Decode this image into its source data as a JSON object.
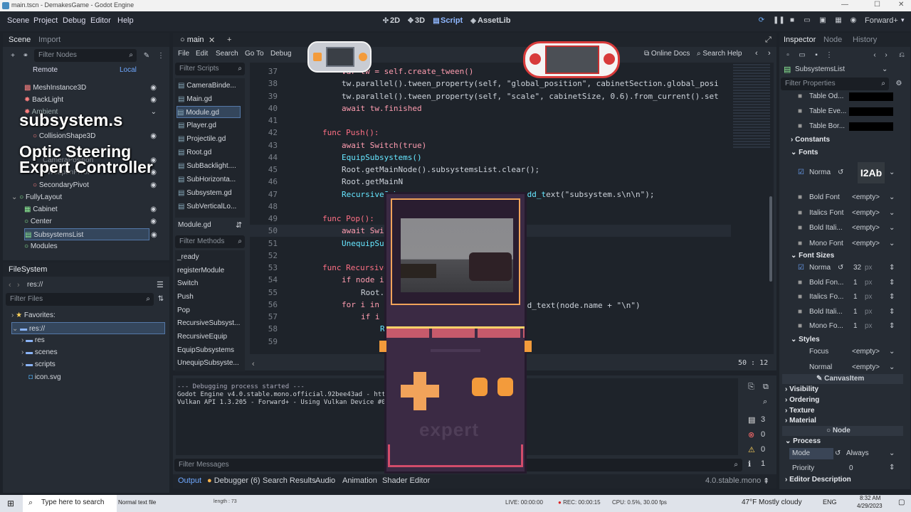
{
  "window": {
    "title": "main.tscn - DemakesGame - Godot Engine"
  },
  "menubar": {
    "items": [
      "Scene",
      "Project",
      "Debug",
      "Editor",
      "Help"
    ],
    "workspaces": [
      "2D",
      "3D",
      "Script",
      "AssetLib"
    ],
    "renderer": "Forward+"
  },
  "scene_dock": {
    "tabs": [
      "Scene",
      "Import"
    ],
    "filter_placeholder": "Filter Nodes",
    "remote": "Remote",
    "local": "Local",
    "nodes": [
      "MeshInstance3D",
      "BackLight",
      "Ambient",
      "",
      "CollisionShape3D",
      "",
      "CameraPosition",
      "WeaponPivot",
      "SecondaryPivot",
      "FullyLayout",
      "Cabinet",
      "Center",
      "SubsystemsList",
      "Modules"
    ]
  },
  "filesystem": {
    "title": "FileSystem",
    "path": "res://",
    "filter_placeholder": "Filter Files",
    "favorites": "Favorites:",
    "items": [
      "res://",
      "res",
      "scenes",
      "scripts",
      "icon.svg"
    ]
  },
  "script_editor": {
    "tab": "main",
    "menu": [
      "File",
      "Edit",
      "Search",
      "Go To",
      "Debug"
    ],
    "online_docs": "Online Docs",
    "search_help": "Search Help",
    "filter_scripts": "Filter Scripts",
    "scripts": [
      "CameraBinde...",
      "Main.gd",
      "Module.gd",
      "Player.gd",
      "Projectile.gd",
      "Root.gd",
      "SubBacklight....",
      "SubHorizonta...",
      "Subsystem.gd",
      "SubVerticalLo..."
    ],
    "current_script": "Module.gd",
    "filter_methods": "Filter Methods",
    "methods": [
      "_ready",
      "registerModule",
      "Switch",
      "Push",
      "Pop",
      "RecursiveSubsyst...",
      "RecursiveEquip",
      "EquipSubsystems",
      "UnequipSubsyste..."
    ],
    "line_numbers": [
      "37",
      "38",
      "39",
      "40",
      "41",
      "42",
      "43",
      "44",
      "45",
      "46",
      "47",
      "48",
      "49",
      "50",
      "51",
      "52",
      "53",
      "54",
      "55",
      "56",
      "57",
      "58",
      "59"
    ],
    "lines": [
      "var tw = self.create_tween()",
      "tw.parallel().tween_property(self, \"global_position\", cabinetSection.global_posi",
      "tw.parallel().tween_property(self, \"scale\", cabinetSize, 0.6).from_current().set",
      "await tw.finished",
      "",
      "func Push():",
      "await Switch(true)",
      "EquipSubsystems()",
      "Root.getMainNode().subsystemsList.clear();",
      "Root.getMainN",
      "RecursiveSubs",
      "",
      "func Pop():",
      "await Switch(",
      "UnequipSubsys",
      "",
      "func RecursiveSub",
      "if node is Su",
      "Root.getM",
      "for i in node",
      "if i is S",
      "Rec",
      ""
    ],
    "line47_tail": "ext(\"subsystem.s\\n\\n\");",
    "line56_tail": "nd_text(node.name + \"\\n\")",
    "cursor": "50 :  12"
  },
  "output": {
    "lines": [
      "--- Debugging process started ---",
      "Godot Engine v4.0.stable.mono.official.92bee43ad - https",
      "Vulkan API 1.3.205 - Forward+ - Using Vulkan Device #0:"
    ],
    "filter": "Filter Messages",
    "counts": [
      "3",
      "0",
      "0",
      "1"
    ],
    "bottom_tabs": [
      "Output",
      "Debugger (6)",
      "Search Results",
      "Audio",
      "Animation",
      "Shader Editor"
    ],
    "version": "4.0.stable.mono"
  },
  "inspector": {
    "tabs": [
      "Inspector",
      "Node",
      "History"
    ],
    "node": "SubsystemsList",
    "filter_placeholder": "Filter Properties",
    "table": [
      "Table Od...",
      "Table Eve...",
      "Table Bor..."
    ],
    "sections": {
      "constants": "Constants",
      "fonts": "Fonts",
      "font_sizes": "Font Sizes",
      "styles": "Styles"
    },
    "fonts": [
      {
        "label": "Norma",
        "value": "I2Ab"
      },
      {
        "label": "Bold Font",
        "value": "<empty>"
      },
      {
        "label": "Italics Font",
        "value": "<empty>"
      },
      {
        "label": "Bold Itali...",
        "value": "<empty>"
      },
      {
        "label": "Mono Font",
        "value": "<empty>"
      }
    ],
    "font_sizes": [
      {
        "label": "Norma",
        "value": "32",
        "unit": "px"
      },
      {
        "label": "Bold Fon...",
        "value": "1",
        "unit": "px"
      },
      {
        "label": "Italics Fo...",
        "value": "1",
        "unit": "px"
      },
      {
        "label": "Bold Itali...",
        "value": "1",
        "unit": "px"
      },
      {
        "label": "Mono Fo...",
        "value": "1",
        "unit": "px"
      }
    ],
    "styles": [
      {
        "label": "Focus",
        "value": "<empty>"
      },
      {
        "label": "Normal",
        "value": "<empty>"
      }
    ],
    "canvas_item": "CanvasItem",
    "groups": [
      "Visibility",
      "Ordering",
      "Texture",
      "Material"
    ],
    "node_header": "Node",
    "process": "Process",
    "mode_label": "Mode",
    "mode_value": "Always",
    "priority_label": "Priority",
    "priority_value": "0",
    "editor_description": "Editor Description"
  },
  "overlay": {
    "title": "subsystem.s",
    "line1": "Optic Steering",
    "line2": "Expert Controller",
    "handheld_label": "expert"
  },
  "taskbar": {
    "search": "Type here to search",
    "app1": "Normal text file",
    "app1b": "length : 73",
    "live": "LIVE: 00:00:00",
    "rec": "REC: 00:00:15",
    "cpu": "CPU: 0.5%, 30.00 fps",
    "weather": "47°F  Mostly cloudy",
    "lang": "ENG",
    "time": "8:32 AM",
    "date": "4/29/2023"
  },
  "colors": {
    "accent": "#478cbf",
    "keyword": "#ff7085",
    "function": "#66e6ff",
    "string": "#ffeda1",
    "handheld": "#3b2a44"
  }
}
